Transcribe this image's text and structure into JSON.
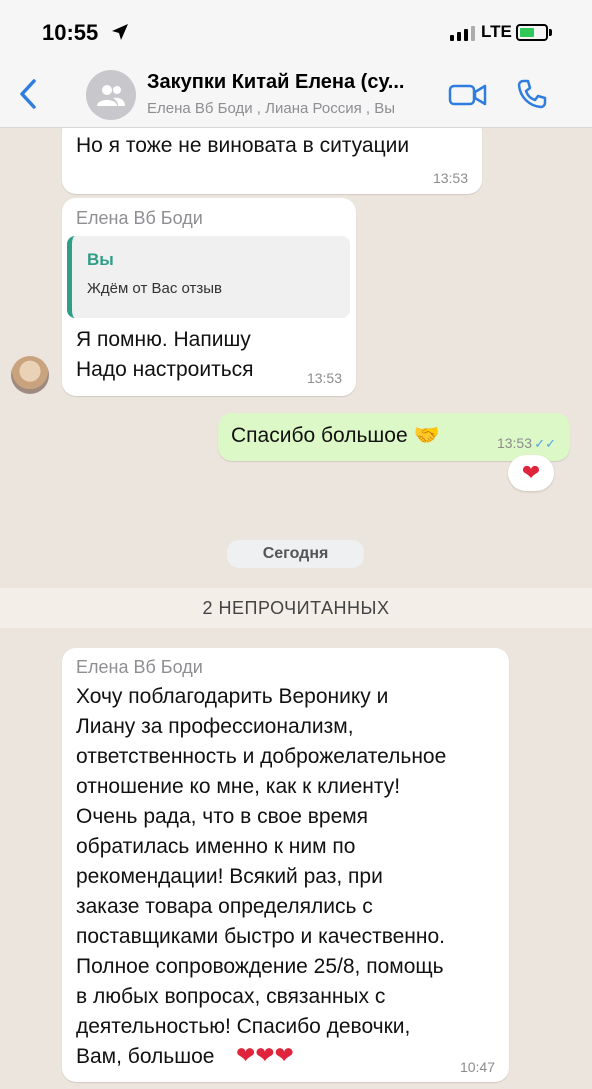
{
  "status_bar": {
    "time": "10:55",
    "network": "LTE"
  },
  "header": {
    "title": "Закупки Китай Елена (су...",
    "subtitle": "Елена Вб Боди , Лиана Россия , Вы"
  },
  "messages": [
    {
      "text": "Но я тоже не виновата в ситуации",
      "time": "13:53"
    },
    {
      "sender": "Елена Вб Боди",
      "quote_author": "Вы",
      "quote_text": "Ждём от Вас отзыв",
      "text": "Я помню. Напишу\nНадо настроиться",
      "time": "13:53"
    },
    {
      "text": "Спасибо большое 🤝",
      "time": "13:53",
      "ticks": "✓✓",
      "reaction": "❤"
    },
    {
      "sender": "Елена Вб Боди",
      "text": "Хочу поблагодарить Веронику и\nЛиану за профессионализм,\nответственность и доброжелательное\nотношение ко мне, как к клиенту!\nОчень рада, что в свое время\nобратилась именно к ним по\nрекомендации! Всякий раз, при\nзаказе товара определялись с\nпоставщиками быстро и качественно.\nПолное сопровождение 25/8, помощь\nв любых вопросах, связанных с\nдеятельностью! Спасибо девочки,\nВам, большое",
      "emoji_tail": "❤❤❤",
      "time": "10:47"
    }
  ],
  "day_separator": "Сегодня",
  "unread_label": "2 НЕПРОЧИТАННЫХ",
  "icons": {
    "back": "chevron-left-icon",
    "avatar": "group-icon",
    "video": "video-camera-icon",
    "call": "phone-icon"
  },
  "colors": {
    "accent": "#2f7ddf",
    "quote_accent": "#2f9e86",
    "outgoing_bubble": "#dcf8c6"
  }
}
